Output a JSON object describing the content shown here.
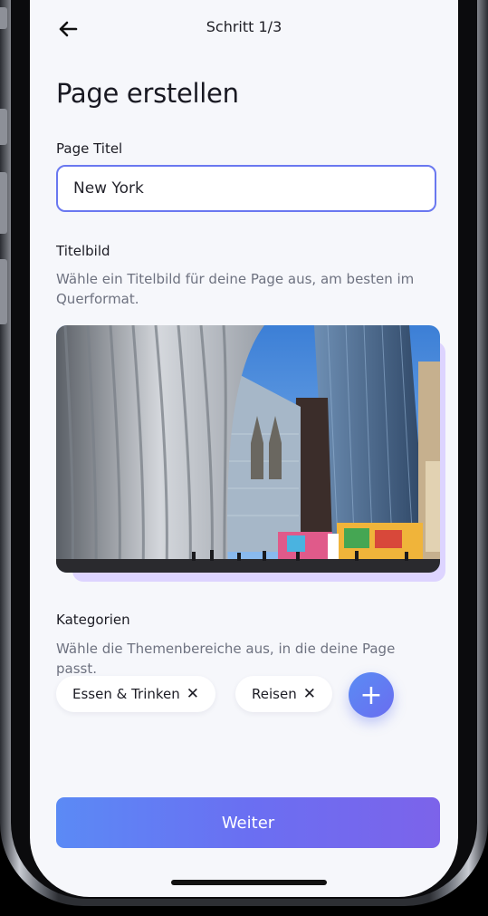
{
  "header": {
    "back_icon": "arrow-left-icon",
    "step": "Schritt 1/3"
  },
  "page": {
    "title": "Page erstellen"
  },
  "page_title_field": {
    "label": "Page Titel",
    "value": "New York",
    "accent_color": "#6a78f0"
  },
  "cover": {
    "label": "Titelbild",
    "hint": "Wähle ein Titelbild für deine Page aus, am besten im Querformat."
  },
  "categories": {
    "label": "Kategorien",
    "hint": "Wähle die Themenbereiche aus, in die deine Page passt.",
    "chips": [
      {
        "label": "Essen & Trinken",
        "remove_icon": "close-icon"
      },
      {
        "label": "Reisen",
        "remove_icon": "close-icon"
      }
    ],
    "add_icon": "plus-icon"
  },
  "footer": {
    "next_label": "Weiter",
    "button_color": "#6a6ff2"
  }
}
